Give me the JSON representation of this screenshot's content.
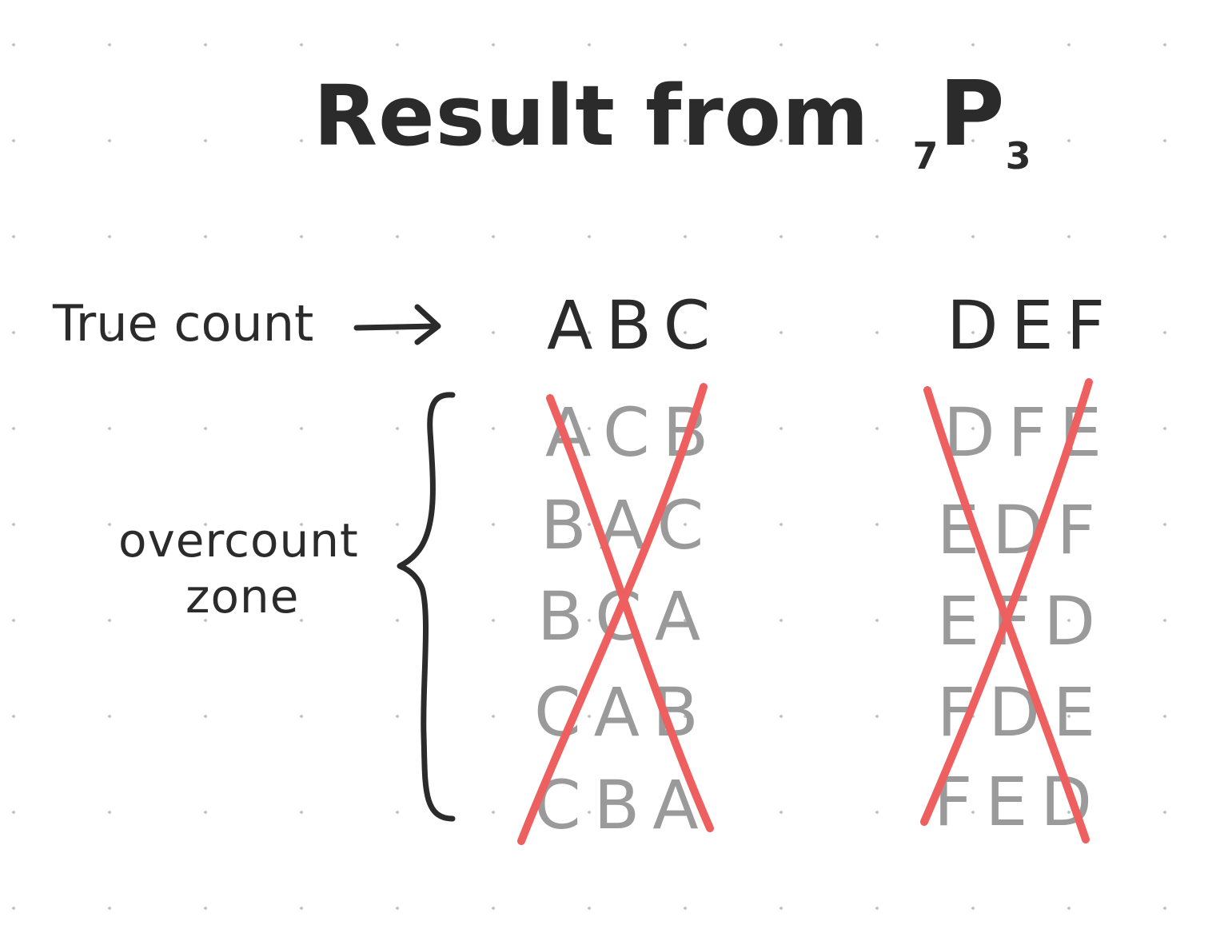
{
  "title": {
    "main": "Result from",
    "sub_left": "7",
    "letter": "P",
    "sub_right": "3"
  },
  "labels": {
    "true_count": "True count",
    "overcount_line1": "overcount",
    "overcount_line2": "zone"
  },
  "groups": [
    {
      "true_row": "ABC",
      "overcount_rows": [
        "ACB",
        "BAC",
        "BCA",
        "CAB",
        "CBA"
      ]
    },
    {
      "true_row": "DEF",
      "overcount_rows": [
        "DFE",
        "EDF",
        "EFD",
        "FDE",
        "FED"
      ]
    }
  ],
  "colors": {
    "ink": "#2b2b2b",
    "gray_text": "#9a9a9a",
    "cross": "#ee5f5f"
  }
}
